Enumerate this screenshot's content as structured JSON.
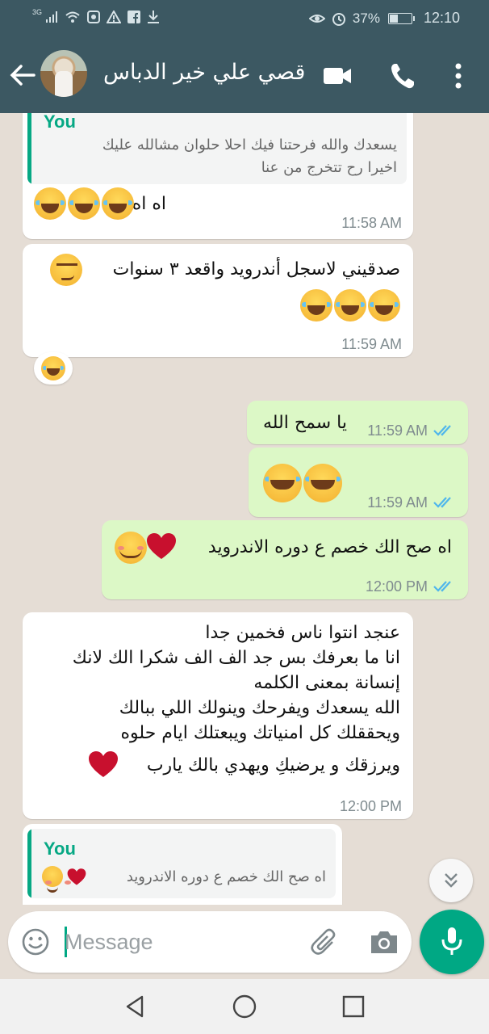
{
  "status_bar": {
    "network": "3G",
    "battery_text": "37%",
    "battery_level": 0.37,
    "time": "12:10"
  },
  "header": {
    "contact_name": "قصي علي خير الدباس",
    "icons": [
      "back-arrow-icon",
      "video-call-icon",
      "voice-call-icon",
      "more-options-icon"
    ]
  },
  "messages": [
    {
      "direction": "incoming",
      "quote": {
        "author": "You",
        "lines": [
          "يسعدك والله فرحتنا فيك احلا حلوان مشالله عليك",
          "اخيرا رح تتخرج من عنا"
        ]
      },
      "text": "اه اه",
      "emojis": [
        "joy",
        "joy",
        "joy"
      ],
      "time": "11:58 AM"
    },
    {
      "direction": "incoming",
      "text": "صدقيني لاسجل أندرويد واقعد ٣ سنوات",
      "emojis": [
        "smirk",
        "joy",
        "joy",
        "joy"
      ],
      "time": "11:59 AM",
      "reaction": "joy"
    },
    {
      "direction": "outgoing",
      "text": "يا سمح الله",
      "time": "11:59 AM",
      "status": "read"
    },
    {
      "direction": "outgoing",
      "emojis": [
        "joy",
        "joy"
      ],
      "time": "11:59 AM",
      "status": "read"
    },
    {
      "direction": "outgoing",
      "text": "اه صح الك خصم ع دوره الاندرويد",
      "emojis": [
        "heart",
        "blush"
      ],
      "time": "12:00 PM",
      "status": "read"
    },
    {
      "direction": "incoming",
      "lines": [
        "عنجد انتوا ناس فخمين جدا",
        "انا ما بعرفك بس جد الف الف شكرا الك لانك",
        "إنسانة بمعنى الكلمه",
        "الله يسعدك ويفرحك وينولك اللي ببالك",
        "ويحققلك كل امنياتك ويبعتلك ايام حلوه",
        "ويرزقك و يرضيكِ ويهدي بالك يارب"
      ],
      "emojis": [
        "heart"
      ],
      "time": "12:00 PM"
    },
    {
      "direction": "incoming",
      "quote": {
        "author": "You",
        "lines": [
          "اه صح الك خصم ع دوره الاندرويد"
        ]
      },
      "emojis": [
        "heart",
        "blush"
      ]
    }
  ],
  "input": {
    "placeholder": "Message",
    "icons": [
      "emoji-icon",
      "attach-icon",
      "camera-icon",
      "mic-icon"
    ]
  },
  "colors": {
    "header": "#3c5862",
    "outgoing_bubble": "#dcf8c6",
    "incoming_bubble": "#ffffff",
    "accent": "#00a884",
    "read_ticks": "#4fb6ec"
  }
}
